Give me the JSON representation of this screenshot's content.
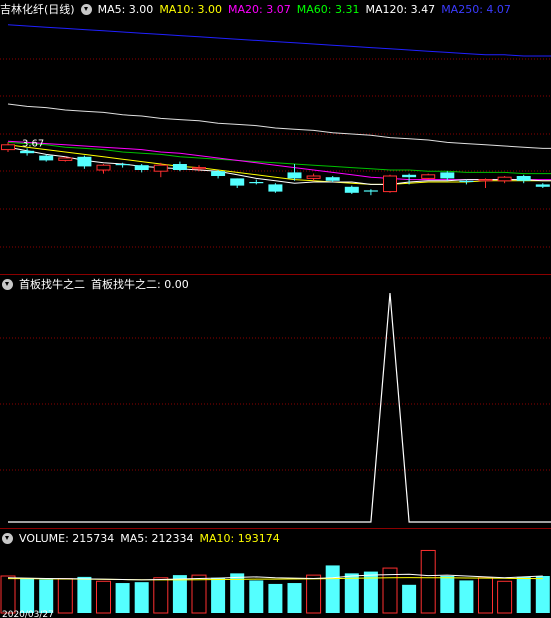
{
  "main": {
    "title": "吉林化纤(日线)",
    "ma": [
      {
        "label": "MA5: 3.00",
        "color": "#ffffff"
      },
      {
        "label": "MA10: 3.00",
        "color": "#ffff00"
      },
      {
        "label": "MA20: 3.07",
        "color": "#ff00ff"
      },
      {
        "label": "MA60: 3.31",
        "color": "#00ff00"
      },
      {
        "label": "MA120: 3.47",
        "color": "#ffffff"
      },
      {
        "label": "MA250: 4.07",
        "color": "#3b3bff"
      }
    ],
    "price_label": "3.67",
    "candles": [
      {
        "o": 3.62,
        "c": 3.66,
        "h": 3.68,
        "l": 3.6
      },
      {
        "o": 3.61,
        "c": 3.59,
        "h": 3.63,
        "l": 3.57
      },
      {
        "o": 3.57,
        "c": 3.53,
        "h": 3.58,
        "l": 3.52
      },
      {
        "o": 3.53,
        "c": 3.55,
        "h": 3.56,
        "l": 3.52
      },
      {
        "o": 3.56,
        "c": 3.48,
        "h": 3.57,
        "l": 3.46
      },
      {
        "o": 3.45,
        "c": 3.49,
        "h": 3.5,
        "l": 3.42
      },
      {
        "o": 3.5,
        "c": 3.49,
        "h": 3.51,
        "l": 3.47
      },
      {
        "o": 3.49,
        "c": 3.45,
        "h": 3.5,
        "l": 3.43
      },
      {
        "o": 3.44,
        "c": 3.49,
        "h": 3.51,
        "l": 3.39
      },
      {
        "o": 3.5,
        "c": 3.45,
        "h": 3.52,
        "l": 3.44
      },
      {
        "o": 3.46,
        "c": 3.47,
        "h": 3.49,
        "l": 3.44
      },
      {
        "o": 3.44,
        "c": 3.4,
        "h": 3.45,
        "l": 3.38
      },
      {
        "o": 3.38,
        "c": 3.32,
        "h": 3.38,
        "l": 3.3
      },
      {
        "o": 3.35,
        "c": 3.34,
        "h": 3.37,
        "l": 3.33
      },
      {
        "o": 3.33,
        "c": 3.27,
        "h": 3.34,
        "l": 3.26
      },
      {
        "o": 3.43,
        "c": 3.38,
        "h": 3.5,
        "l": 3.36
      },
      {
        "o": 3.38,
        "c": 3.4,
        "h": 3.42,
        "l": 3.36
      },
      {
        "o": 3.39,
        "c": 3.36,
        "h": 3.4,
        "l": 3.35
      },
      {
        "o": 3.31,
        "c": 3.26,
        "h": 3.32,
        "l": 3.25
      },
      {
        "o": 3.28,
        "c": 3.27,
        "h": 3.29,
        "l": 3.24
      },
      {
        "o": 3.27,
        "c": 3.4,
        "h": 3.41,
        "l": 3.26
      },
      {
        "o": 3.41,
        "c": 3.39,
        "h": 3.42,
        "l": 3.33
      },
      {
        "o": 3.38,
        "c": 3.41,
        "h": 3.42,
        "l": 3.37
      },
      {
        "o": 3.43,
        "c": 3.38,
        "h": 3.44,
        "l": 3.36
      },
      {
        "o": 3.36,
        "c": 3.35,
        "h": 3.37,
        "l": 3.33
      },
      {
        "o": 3.36,
        "c": 3.37,
        "h": 3.38,
        "l": 3.3
      },
      {
        "o": 3.36,
        "c": 3.39,
        "h": 3.4,
        "l": 3.34
      },
      {
        "o": 3.4,
        "c": 3.36,
        "h": 3.41,
        "l": 3.34
      },
      {
        "o": 3.33,
        "c": 3.31,
        "h": 3.34,
        "l": 3.3
      }
    ],
    "ma5": [
      3.64,
      3.61,
      3.58,
      3.56,
      3.53,
      3.51,
      3.5,
      3.48,
      3.47,
      3.46,
      3.45,
      3.44,
      3.41,
      3.38,
      3.36,
      3.34,
      3.35,
      3.35,
      3.35,
      3.33,
      3.33,
      3.35,
      3.36,
      3.36,
      3.37,
      3.37,
      3.37,
      3.37,
      3.36
    ],
    "ma10": [
      3.66,
      3.64,
      3.62,
      3.6,
      3.58,
      3.56,
      3.54,
      3.52,
      3.5,
      3.48,
      3.47,
      3.45,
      3.43,
      3.41,
      3.39,
      3.37,
      3.36,
      3.35,
      3.34,
      3.33,
      3.33,
      3.34,
      3.35,
      3.35,
      3.35,
      3.36,
      3.36,
      3.36,
      3.36
    ],
    "ma20": [
      3.69,
      3.68,
      3.67,
      3.66,
      3.65,
      3.64,
      3.63,
      3.62,
      3.6,
      3.59,
      3.57,
      3.55,
      3.53,
      3.51,
      3.49,
      3.47,
      3.45,
      3.43,
      3.41,
      3.39,
      3.38,
      3.37,
      3.37,
      3.37,
      3.37,
      3.37,
      3.37,
      3.37,
      3.37
    ],
    "ma60": [
      3.68,
      3.67,
      3.66,
      3.64,
      3.63,
      3.62,
      3.6,
      3.59,
      3.58,
      3.56,
      3.55,
      3.54,
      3.53,
      3.52,
      3.51,
      3.5,
      3.49,
      3.48,
      3.47,
      3.46,
      3.45,
      3.45,
      3.44,
      3.44,
      3.43,
      3.43,
      3.43,
      3.42,
      3.42
    ],
    "ma120": [
      4.0,
      3.98,
      3.97,
      3.95,
      3.94,
      3.93,
      3.91,
      3.9,
      3.88,
      3.87,
      3.86,
      3.84,
      3.83,
      3.82,
      3.8,
      3.79,
      3.78,
      3.76,
      3.75,
      3.74,
      3.72,
      3.71,
      3.7,
      3.68,
      3.67,
      3.66,
      3.65,
      3.64,
      3.63
    ],
    "ma250": [
      4.66,
      4.65,
      4.64,
      4.63,
      4.62,
      4.61,
      4.6,
      4.59,
      4.58,
      4.57,
      4.56,
      4.55,
      4.54,
      4.53,
      4.52,
      4.51,
      4.5,
      4.49,
      4.48,
      4.47,
      4.46,
      4.45,
      4.44,
      4.43,
      4.42,
      4.41,
      4.41,
      4.4,
      4.4
    ]
  },
  "indicator": {
    "name": "首板找牛之二",
    "value_label": "首板找牛之二: 0.00",
    "values": [
      0,
      0,
      0,
      0,
      0,
      0,
      0,
      0,
      0,
      0,
      0,
      0,
      0,
      0,
      0,
      0,
      0,
      0,
      0,
      0,
      1,
      0,
      0,
      0,
      0,
      0,
      0,
      0,
      0
    ]
  },
  "volume": {
    "label": "VOLUME: 215734",
    "ma5_label": "MA5: 212334",
    "ma10_label": "MA10: 193174",
    "bars": [
      210,
      195,
      190,
      195,
      205,
      180,
      170,
      175,
      200,
      215,
      215,
      200,
      225,
      185,
      165,
      170,
      215,
      270,
      225,
      235,
      255,
      160,
      355,
      210,
      185,
      200,
      180,
      205,
      210
    ],
    "ma5": [
      200,
      198,
      196,
      195,
      194,
      192,
      190,
      188,
      190,
      193,
      196,
      198,
      202,
      205,
      200,
      198,
      196,
      200,
      210,
      215,
      218,
      220,
      212,
      215,
      210,
      205,
      200,
      205,
      210
    ],
    "ma10": [
      195,
      195,
      194,
      193,
      192,
      191,
      190,
      189,
      188,
      188,
      189,
      190,
      191,
      192,
      192,
      193,
      194,
      195,
      197,
      199,
      200,
      201,
      200,
      200,
      199,
      198,
      197,
      196,
      195
    ]
  },
  "date_label": "2020/03/27"
}
